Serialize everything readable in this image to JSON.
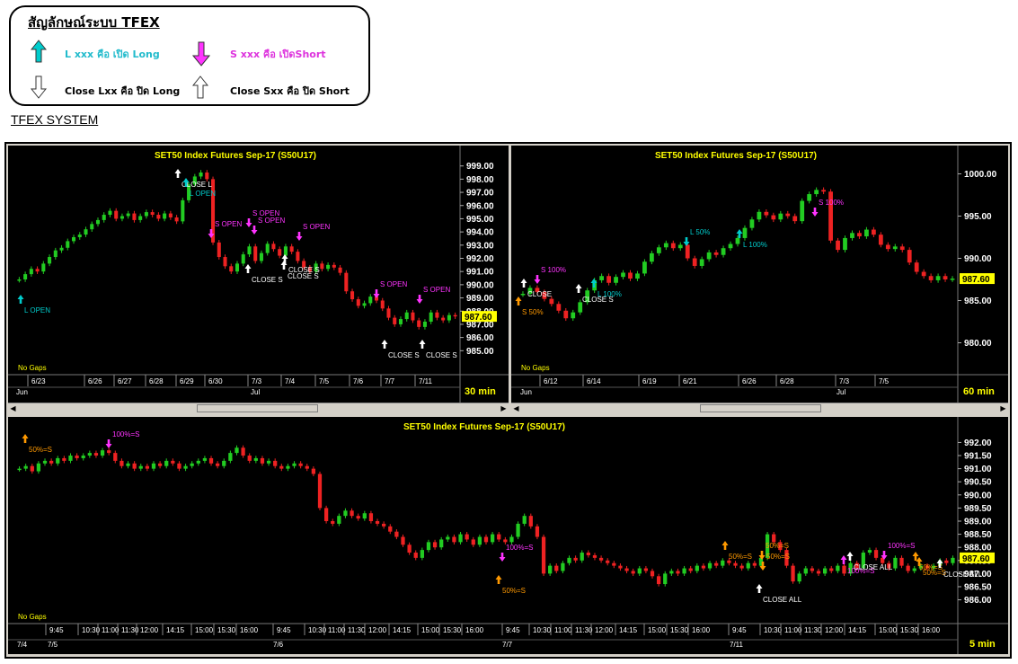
{
  "legend": {
    "title": "สัญลักษณ์ระบบ TFEX",
    "long_open": "L xxx คือ เปิด Long",
    "short_open": "S xxx คือ เปิดShort",
    "close_long": "Close Lxx คือ ปิด Long",
    "close_short": "Close Sxx คือ ปิด Short"
  },
  "system_label": "TFEX SYSTEM",
  "colors": {
    "bg": "#000000",
    "up": "#22cc22",
    "down": "#ee2222",
    "title": "#ffff00",
    "axis_text": "#ffffff",
    "long": "#00cccc",
    "short": "#ff33ff",
    "close": "#ffffff",
    "pct": "#ff9900",
    "last_price_bg": "#ffff00"
  },
  "chart_data": [
    {
      "type": "candlestick",
      "title": "SET50  Index  Futures  Sep-17  (S50U17)",
      "timeframe": "30  min",
      "note": "No Gaps",
      "last_price": "987.60",
      "ylim": [
        984.0,
        1000.0
      ],
      "yticks": [
        "999.00",
        "998.00",
        "997.00",
        "996.00",
        "995.00",
        "994.00",
        "993.00",
        "992.00",
        "991.00",
        "990.00",
        "989.00",
        "988.00",
        "987.00",
        "986.00",
        "985.00"
      ],
      "ytick_values": [
        999,
        998,
        997,
        996,
        995,
        994,
        993,
        992,
        991,
        990,
        989,
        988,
        987,
        986,
        985
      ],
      "xticks": [
        "6/23",
        "6/26",
        "6/27",
        "6/28",
        "6/29",
        "6/30",
        "7/3",
        "7/4",
        "7/5",
        "7/6",
        "7/7",
        "7/11"
      ],
      "xmonths": [
        "Jun",
        "Jul"
      ],
      "closes": [
        990.4,
        990.8,
        991.2,
        991.0,
        991.6,
        992.1,
        992.6,
        992.8,
        993.3,
        993.6,
        993.8,
        994.2,
        994.6,
        994.9,
        995.3,
        995.6,
        995.0,
        995.2,
        995.4,
        994.9,
        995.2,
        995.5,
        995.3,
        995.0,
        995.4,
        995.1,
        994.8,
        996.4,
        997.6,
        998.2,
        998.5,
        998.0,
        993.2,
        992.1,
        991.4,
        991.0,
        991.6,
        992.3,
        992.9,
        991.8,
        992.4,
        993.1,
        992.7,
        992.2,
        992.9,
        992.5,
        991.8,
        991.3,
        991.0,
        991.6,
        991.2,
        991.5,
        991.3,
        990.9,
        989.5,
        988.9,
        988.4,
        988.6,
        989.1,
        988.8,
        988.2,
        987.5,
        987.0,
        987.4,
        987.9,
        987.3,
        986.8,
        987.2,
        987.9,
        987.5,
        987.3,
        987.7,
        987.6
      ],
      "annotations": [
        {
          "label": "L  OPEN",
          "kind": "long"
        },
        {
          "label": "CLOSE  L",
          "kind": "close"
        },
        {
          "label": "L  OPEN",
          "kind": "long"
        },
        {
          "label": "S  OPEN",
          "kind": "short"
        },
        {
          "label": "S  OPEN",
          "kind": "short"
        },
        {
          "label": "S  OPEN",
          "kind": "short"
        },
        {
          "label": "S  OPEN",
          "kind": "short"
        },
        {
          "label": "CLOSE  S",
          "kind": "close"
        },
        {
          "label": "CLOSE  S",
          "kind": "close"
        },
        {
          "label": "CLOSE  S",
          "kind": "close"
        },
        {
          "label": "S  OPEN",
          "kind": "short"
        },
        {
          "label": "S  OPEN",
          "kind": "short"
        },
        {
          "label": "CLOSE  S",
          "kind": "close"
        },
        {
          "label": "CLOSE  S",
          "kind": "close"
        }
      ]
    },
    {
      "type": "candlestick",
      "title": "SET50  Index  Futures  Sep-17  (S50U17)",
      "timeframe": "60  min",
      "note": "No Gaps",
      "last_price": "987.60",
      "ylim": [
        977.5,
        1002.5
      ],
      "yticks": [
        "1000.00",
        "995.00",
        "990.00",
        "985.00",
        "980.00"
      ],
      "ytick_values": [
        1000,
        995,
        990,
        985,
        980
      ],
      "xticks": [
        "6/12",
        "6/14",
        "6/19",
        "6/21",
        "6/26",
        "6/28",
        "7/3",
        "7/5"
      ],
      "xmonths": [
        "Jun",
        "Jul"
      ],
      "closes": [
        985.8,
        986.5,
        986.0,
        985.2,
        984.6,
        983.8,
        982.9,
        983.6,
        984.8,
        986.2,
        987.4,
        987.9,
        987.1,
        987.8,
        988.3,
        987.6,
        988.2,
        989.6,
        990.6,
        991.3,
        991.8,
        991.2,
        991.6,
        990.0,
        989.1,
        989.9,
        990.7,
        990.4,
        991.2,
        991.7,
        992.4,
        993.6,
        994.6,
        995.5,
        995.1,
        994.6,
        995.3,
        995.0,
        994.4,
        996.8,
        997.6,
        998.1,
        997.9,
        992.1,
        991.0,
        992.4,
        993.0,
        992.6,
        993.4,
        992.8,
        991.6,
        991.1,
        991.4,
        991.0,
        989.5,
        988.4,
        987.9,
        987.4,
        987.9,
        987.5,
        987.6
      ],
      "annotations": [
        {
          "label": "S  100%",
          "kind": "short"
        },
        {
          "label": "CLOSE",
          "kind": "close"
        },
        {
          "label": "S  50%",
          "kind": "pct"
        },
        {
          "label": "CLOSE  S",
          "kind": "close"
        },
        {
          "label": "L  100%",
          "kind": "long"
        },
        {
          "label": "L  50%",
          "kind": "long"
        },
        {
          "label": "L  100%",
          "kind": "long"
        },
        {
          "label": "S  100%",
          "kind": "short"
        }
      ]
    },
    {
      "type": "candlestick",
      "title": "SET50  Index  Futures  Sep-17  (S50U17)",
      "timeframe": "5  min",
      "note": "No Gaps",
      "last_price": "987.60",
      "ylim": [
        985.3,
        992.7
      ],
      "yticks": [
        "992.00",
        "991.50",
        "991.00",
        "990.50",
        "990.00",
        "989.50",
        "989.00",
        "988.50",
        "988.00",
        "987.50",
        "987.00",
        "986.50",
        "986.00"
      ],
      "ytick_values": [
        992,
        991.5,
        991,
        990.5,
        990,
        989.5,
        989,
        988.5,
        988,
        987.5,
        987,
        986.5,
        986
      ],
      "xticks": [
        "9:45",
        "10:30",
        "11:00",
        "11:30",
        "12:00",
        "14:15",
        "15:00",
        "15:30",
        "16:00",
        "9:45",
        "10:30",
        "11:00",
        "11:30",
        "12:00",
        "14:15",
        "15:00",
        "15:30",
        "16:00",
        "9:45",
        "10:30",
        "11:00",
        "11:30",
        "12:00",
        "14:15",
        "15:00",
        "15:30",
        "16:00",
        "9:45",
        "10:30",
        "11:00",
        "11:30",
        "12:00",
        "14:15",
        "15:00",
        "15:30",
        "16:00"
      ],
      "xdates": [
        "7/4",
        "7/5",
        "7/6",
        "7/7",
        "7/11"
      ],
      "closes": [
        991.0,
        991.1,
        990.9,
        991.2,
        991.3,
        991.2,
        991.4,
        991.3,
        991.5,
        991.4,
        991.5,
        991.6,
        991.5,
        991.7,
        991.6,
        991.3,
        991.1,
        991.2,
        991.0,
        991.1,
        991.0,
        991.2,
        991.1,
        991.3,
        991.2,
        991.0,
        991.1,
        991.2,
        991.3,
        991.4,
        991.2,
        991.1,
        991.3,
        991.6,
        991.8,
        991.5,
        991.3,
        991.4,
        991.2,
        991.3,
        991.1,
        991.0,
        991.1,
        991.2,
        991.1,
        991.0,
        990.8,
        989.5,
        989.0,
        988.9,
        989.2,
        989.4,
        989.2,
        989.1,
        989.3,
        989.0,
        988.9,
        988.8,
        988.6,
        988.4,
        988.1,
        987.8,
        987.6,
        987.9,
        988.2,
        988.0,
        988.3,
        988.4,
        988.2,
        988.5,
        988.3,
        988.1,
        988.4,
        988.2,
        988.5,
        988.3,
        988.2,
        988.4,
        988.9,
        989.2,
        988.8,
        988.4,
        987.0,
        987.3,
        987.1,
        987.4,
        987.6,
        987.5,
        987.8,
        987.7,
        987.6,
        987.5,
        987.4,
        987.3,
        987.2,
        987.1,
        987.0,
        987.2,
        987.1,
        986.9,
        986.6,
        987.0,
        987.1,
        987.0,
        987.2,
        987.1,
        987.3,
        987.2,
        987.4,
        987.3,
        987.5,
        987.4,
        987.3,
        987.2,
        987.4,
        987.3,
        987.6,
        988.5,
        988.2,
        987.9,
        987.3,
        986.7,
        987.0,
        987.2,
        987.1,
        987.0,
        987.2,
        987.1,
        987.3,
        987.0,
        987.4,
        987.2,
        987.8,
        987.9,
        987.6,
        987.4,
        987.2,
        987.6,
        987.3,
        987.1,
        987.2,
        987.3,
        987.2,
        987.3,
        987.5,
        987.4,
        987.6
      ],
      "annotations": [
        {
          "label": "50%=S",
          "kind": "pct"
        },
        {
          "label": "100%=S",
          "kind": "short"
        },
        {
          "label": "100%=S",
          "kind": "short"
        },
        {
          "label": "50%=S",
          "kind": "pct"
        },
        {
          "label": "50%=S",
          "kind": "pct"
        },
        {
          "label": "50%=S",
          "kind": "pct"
        },
        {
          "label": "100%=S",
          "kind": "short"
        },
        {
          "label": "CLOSE  ALL",
          "kind": "close"
        },
        {
          "label": "CLOSE  ALL",
          "kind": "close"
        },
        {
          "label": "50%=S",
          "kind": "pct"
        },
        {
          "label": "100%=S",
          "kind": "short"
        },
        {
          "label": "50%=S",
          "kind": "pct"
        },
        {
          "label": "CLOSE  ALL",
          "kind": "close"
        },
        {
          "label": "50%=S",
          "kind": "pct"
        }
      ]
    }
  ]
}
